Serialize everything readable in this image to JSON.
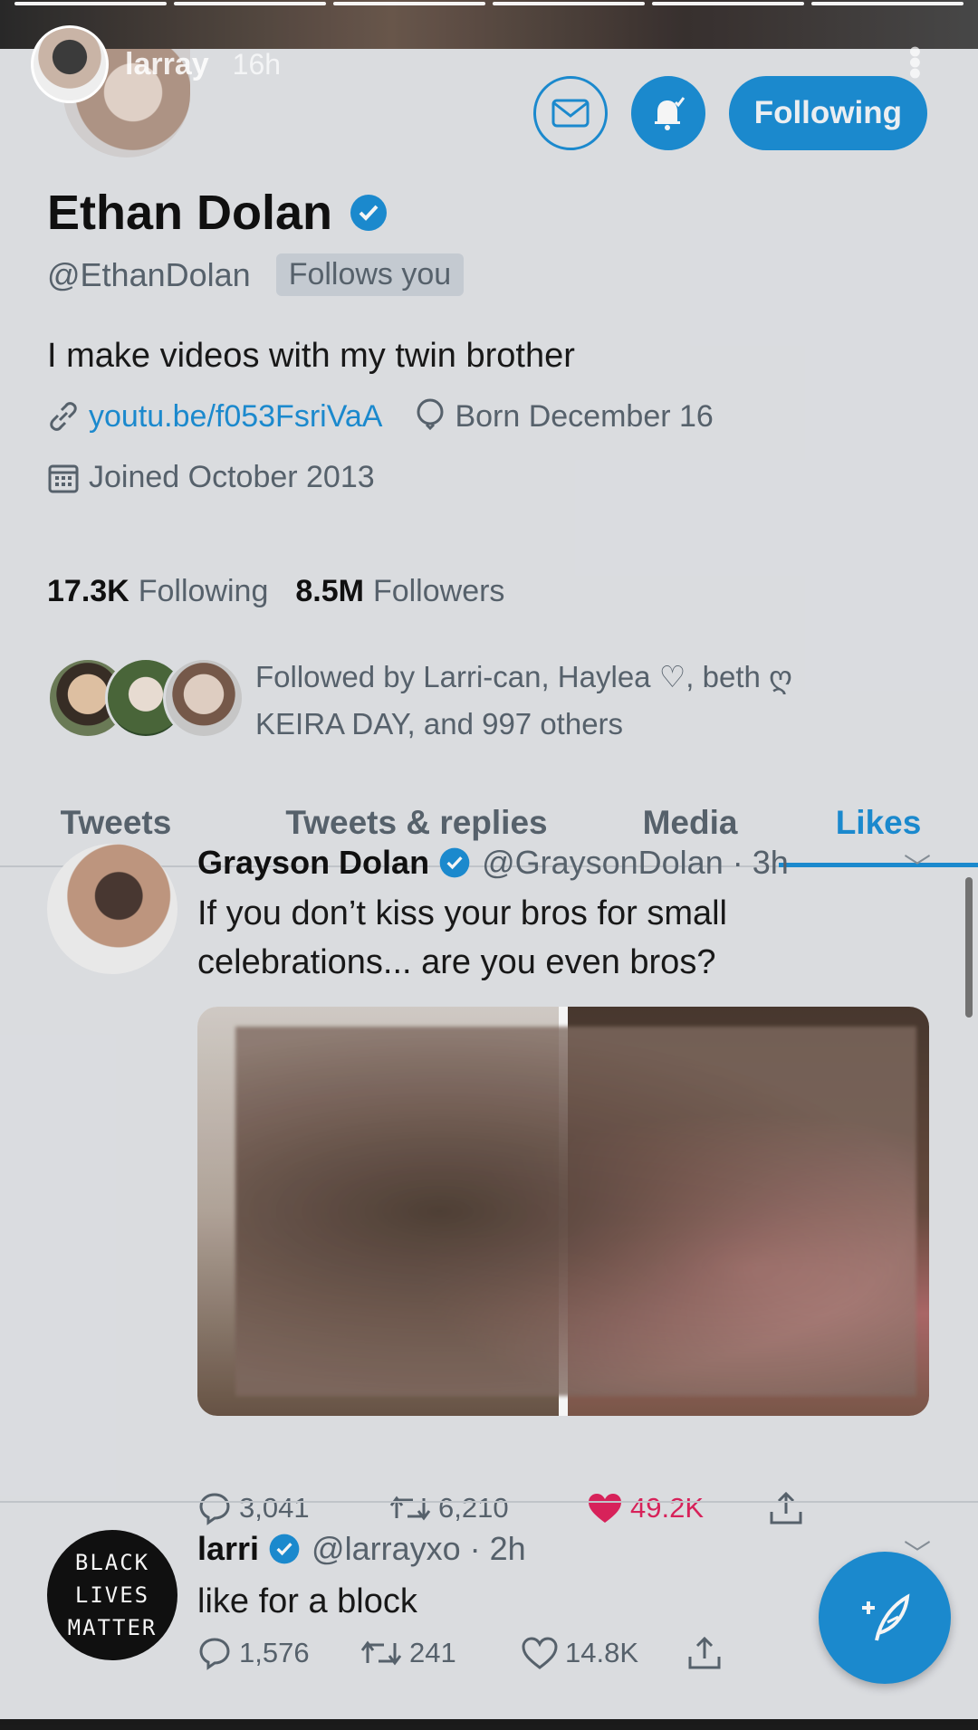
{
  "story": {
    "username": "larray",
    "time": "16h",
    "progress_segments": 6,
    "progress_done": 1
  },
  "profile": {
    "name": "Ethan Dolan",
    "handle": "@EthanDolan",
    "follows_you": "Follows you",
    "bio": "I make videos with my twin brother",
    "link": "youtu.be/f053FsriVaA",
    "born": "Born December 16",
    "joined": "Joined October 2013",
    "following_count": "17.3K",
    "following_label": "Following",
    "followers_count": "8.5M",
    "followers_label": "Followers",
    "followed_by_line1": "Followed by Larri-can, Haylea ♡, beth ღ",
    "followed_by_line2": "KEIRA DAY, and 997 others",
    "follow_button": "Following"
  },
  "tabs": [
    "Tweets",
    "Tweets & replies",
    "Media",
    "Likes"
  ],
  "active_tab": "Likes",
  "tweets": [
    {
      "name": "Grayson Dolan",
      "handle": "@GraysonDolan · 3h",
      "text": "If you don’t kiss your bros for small celebrations... are you even bros?",
      "replies": "3,041",
      "retweets": "6,210",
      "likes": "49.2K",
      "liked": true
    },
    {
      "name": "larri",
      "handle": "@larrayxo · 2h",
      "text": "like for a block",
      "avatar_text": [
        "BLACK",
        "LIVES",
        "MATTER"
      ],
      "replies": "1,576",
      "retweets": "241",
      "likes": "14.8K",
      "liked": false
    }
  ],
  "colors": {
    "accent": "#1d8fd6",
    "like": "#e0245e",
    "background": "#e3e5e9",
    "muted_text": "#5a6570"
  },
  "icons": {
    "message": "envelope-icon",
    "notify": "bell-icon",
    "link": "link-icon",
    "born": "balloon-icon",
    "joined": "calendar-icon",
    "verified": "verified-badge-icon",
    "reply": "reply-icon",
    "retweet": "retweet-icon",
    "like": "heart-icon",
    "share": "share-icon",
    "compose": "compose-feather-icon"
  }
}
